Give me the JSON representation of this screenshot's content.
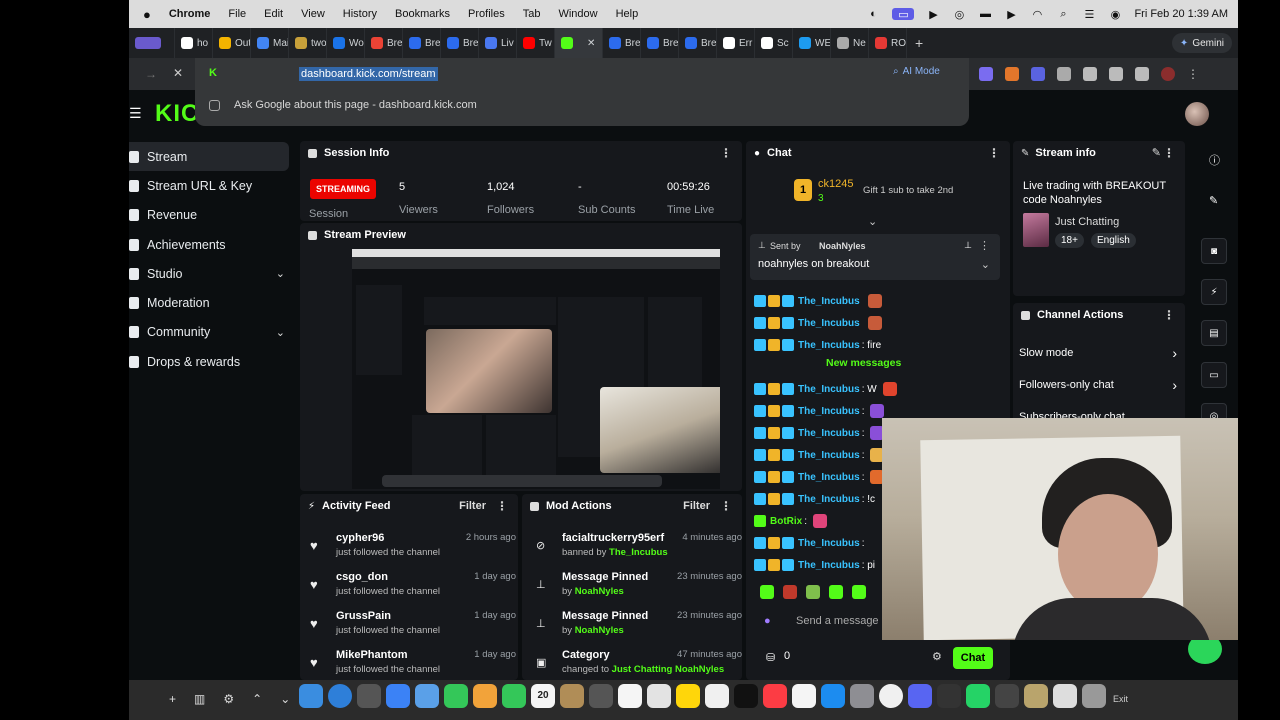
{
  "menubar": {
    "app": "Chrome",
    "items": [
      "File",
      "Edit",
      "View",
      "History",
      "Bookmarks",
      "Profiles",
      "Tab",
      "Window",
      "Help"
    ],
    "datetime": "Fri Feb 20  1:39 AM"
  },
  "tabs": [
    {
      "label": "ho",
      "color": "#ffffff"
    },
    {
      "label": "Out",
      "color": "#f4b400"
    },
    {
      "label": "Mai",
      "color": "#4285f4"
    },
    {
      "label": "two",
      "color": "#c7a03a"
    },
    {
      "label": "Wo",
      "color": "#1a73e8"
    },
    {
      "label": "Bre",
      "color": "#ea4335"
    },
    {
      "label": "Bre",
      "color": "#2c6bed"
    },
    {
      "label": "Bre",
      "color": "#2c6bed"
    },
    {
      "label": "Liv",
      "color": "#4a78f0"
    },
    {
      "label": "Tw",
      "color": "#ff0000"
    },
    {
      "label": "",
      "color": "#53fc18"
    },
    {
      "label": "Bre",
      "color": "#2c6bed"
    },
    {
      "label": "Bre",
      "color": "#2c6bed"
    },
    {
      "label": "Bre",
      "color": "#2c6bed"
    },
    {
      "label": "Err",
      "color": "#ffffff"
    },
    {
      "label": "Sc",
      "color": "#ffffff"
    },
    {
      "label": "WE",
      "color": "#1d9bf0"
    },
    {
      "label": "Ne",
      "color": "#aaaaaa"
    },
    {
      "label": "RO",
      "color": "#e53935"
    }
  ],
  "gemini": "Gemini",
  "url": "dashboard.kick.com/stream",
  "ai_mode": "AI Mode",
  "suggest": "Ask Google about this page - dashboard.kick.com",
  "logo": "KICK",
  "sidebar": [
    {
      "label": "Stream",
      "active": true
    },
    {
      "label": "Stream URL & Key"
    },
    {
      "label": "Revenue"
    },
    {
      "label": "Achievements"
    },
    {
      "label": "Studio",
      "chevron": "⌄"
    },
    {
      "label": "Moderation"
    },
    {
      "label": "Community",
      "chevron": "⌄"
    },
    {
      "label": "Drops & rewards"
    }
  ],
  "session": {
    "title": "Session Info",
    "status": "STREAMING",
    "viewers": "5",
    "viewers_label": "Viewers",
    "followers": "1,024",
    "followers_label": "Followers",
    "subs": "-",
    "subs_label": "Sub Counts",
    "time": "00:59:26",
    "time_label": "Time Live",
    "session_label": "Session"
  },
  "preview_title": "Stream Preview",
  "activity": {
    "title": "Activity Feed",
    "filter": "Filter",
    "rows": [
      {
        "name": "cypher96",
        "sub": "just followed the channel",
        "time": "2 hours ago"
      },
      {
        "name": "csgo_don",
        "sub": "just followed the channel",
        "time": "1 day ago"
      },
      {
        "name": "GrussPain",
        "sub": "just followed the channel",
        "time": "1 day ago"
      },
      {
        "name": "MikePhantom",
        "sub": "just followed the channel",
        "time": "1 day ago"
      }
    ]
  },
  "mod": {
    "title": "Mod Actions",
    "filter": "Filter",
    "rows": [
      {
        "name": "facialtruckerry95erf",
        "pre": "banned by ",
        "by": "The_Incubus",
        "time": "4 minutes ago"
      },
      {
        "name": "Message Pinned",
        "pre": "by ",
        "by": "NoahNyles",
        "time": "23 minutes ago"
      },
      {
        "name": "Message Pinned",
        "pre": "by ",
        "by": "NoahNyles",
        "time": "23 minutes ago"
      },
      {
        "name": "Category",
        "pre": "changed to ",
        "by": "Just Chatting",
        "by2": "NoahNyles",
        "time": "47 minutes ago"
      }
    ]
  },
  "chat": {
    "title": "Chat",
    "gifter": "ck1245",
    "gifter_count": "3",
    "gift_text": "Gift 1 sub to take 2nd",
    "pinned_by_label": "Sent by",
    "pinned_by": "NoahNyles",
    "pinned_text": "noahnyles on breakout",
    "new_messages": "New messages",
    "messages": [
      {
        "user": "The_Incubus",
        "text": "",
        "color": "#39c3ff"
      },
      {
        "user": "The_Incubus",
        "text": "",
        "color": "#39c3ff"
      },
      {
        "user": "The_Incubus",
        "text": ": fire",
        "color": "#39c3ff"
      },
      {
        "user": "The_Incubus",
        "text": ": W",
        "color": "#39c3ff"
      },
      {
        "user": "The_Incubus",
        "text": ":",
        "color": "#39c3ff"
      },
      {
        "user": "The_Incubus",
        "text": ":",
        "color": "#39c3ff"
      },
      {
        "user": "The_Incubus",
        "text": ":",
        "color": "#39c3ff"
      },
      {
        "user": "The_Incubus",
        "text": ":",
        "color": "#39c3ff"
      },
      {
        "user": "The_Incubus",
        "text": ": !c",
        "color": "#39c3ff"
      },
      {
        "user": "BotRix",
        "text": ":",
        "color": "#53fc18"
      },
      {
        "user": "The_Incubus",
        "text": ":",
        "color": "#39c3ff"
      },
      {
        "user": "The_Incubus",
        "text": ": pi",
        "color": "#39c3ff"
      }
    ],
    "placeholder": "Send a message",
    "points": "0",
    "send": "Chat"
  },
  "stream_info": {
    "title": "Stream info",
    "stream_title": "Live trading with BREAKOUT code Noahnyles",
    "category": "Just Chatting",
    "tag1": "18+",
    "tag2": "English"
  },
  "channel_actions": {
    "title": "Channel Actions",
    "items": [
      "Slow mode",
      "Followers-only chat",
      "Subscribers-only chat"
    ]
  },
  "dock": {
    "date": "20",
    "exit": "Exit"
  }
}
